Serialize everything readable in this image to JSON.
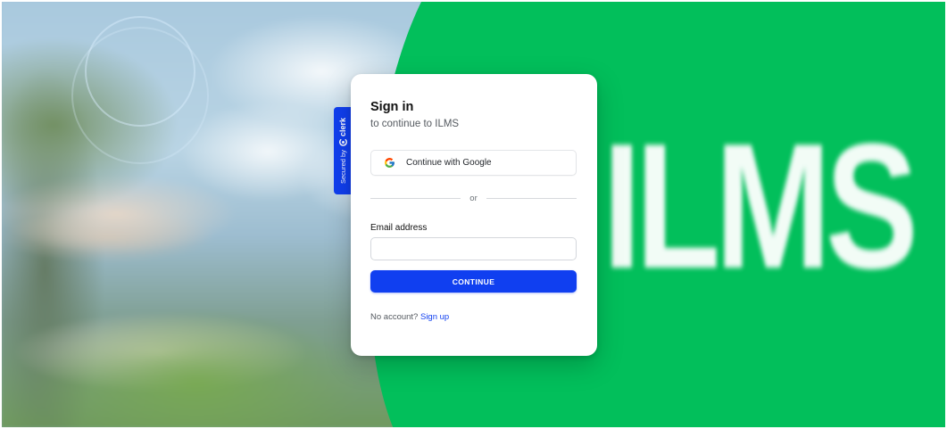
{
  "clerk_badge": {
    "secured_label": "Secured by",
    "brand": "clerk",
    "icon": "clerk-logo-icon",
    "color": "#103ff0"
  },
  "background": {
    "brand_text": "ILMS",
    "accent_green": "#02bf5b"
  },
  "signin": {
    "title": "Sign in",
    "subtitle": "to continue to ILMS",
    "google_button_label": "Continue with Google",
    "google_icon": "google-icon",
    "divider_text": "or",
    "email_label": "Email address",
    "email_value": "",
    "email_placeholder": "",
    "continue_label": "CONTINUE",
    "no_account_text": "No account?",
    "signup_link": "Sign up",
    "primary_color": "#103ff0"
  }
}
